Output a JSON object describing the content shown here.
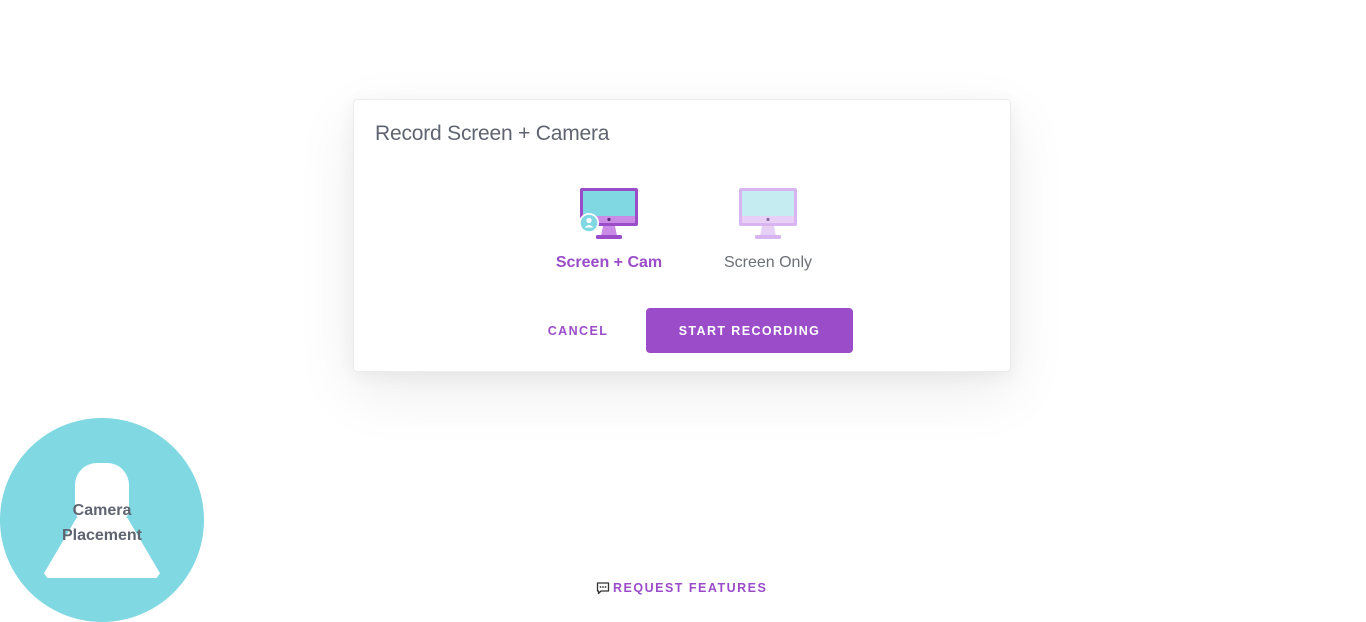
{
  "dialog": {
    "title": "Record Screen + Camera",
    "options": [
      {
        "label": "Screen + Cam",
        "icon": "monitor-with-user-icon",
        "selected": true
      },
      {
        "label": "Screen Only",
        "icon": "monitor-icon",
        "selected": false
      }
    ],
    "cancel_label": "CANCEL",
    "start_label": "START RECORDING"
  },
  "camera_preview": {
    "line1": "Camera",
    "line2": "Placement",
    "icon": "user-silhouette-icon"
  },
  "footer": {
    "request_label": "REQUEST FEATURES",
    "icon": "chat-icon"
  },
  "colors": {
    "accent": "#9b4cc9",
    "accent_light": "#d8b4f0",
    "screen_cyan": "#7fd8e2",
    "screen_cyan_light": "#c4ecf1",
    "text_gray": "#5f6570"
  }
}
